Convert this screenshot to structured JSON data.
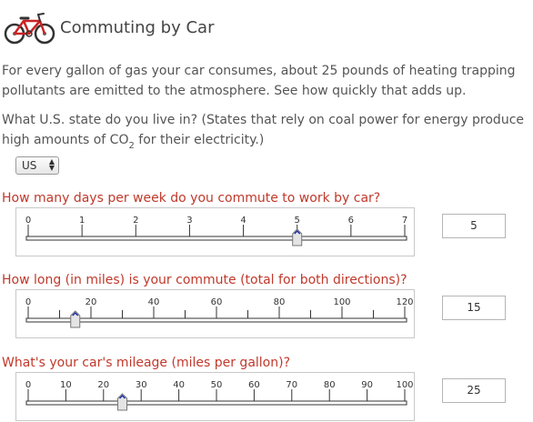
{
  "header": {
    "title": "Commuting by Car",
    "icon": "bicycle-icon"
  },
  "intro": "For every gallon of gas your car consumes, about 25 pounds of heating trapping pollutants are emitted to the atmosphere.  See how quickly that adds up.",
  "state_question": {
    "before": "What U.S. state do you live in? (States that rely on coal power for energy produce high amounts of CO",
    "sub": "2",
    "after": " for their electricity.)"
  },
  "state_select": {
    "value": "US"
  },
  "questions": [
    {
      "label": "How many days per week do you commute to work by car?",
      "min": 0,
      "max": 7,
      "value": 5,
      "tick_labels": [
        "0",
        "1",
        "2",
        "3",
        "4",
        "5",
        "6",
        "7"
      ],
      "minor_ticks": 0,
      "display_value": "5"
    },
    {
      "label": "How long (in miles) is your commute (total for both directions)?",
      "min": 0,
      "max": 120,
      "value": 15,
      "tick_labels": [
        "0",
        "20",
        "40",
        "60",
        "80",
        "100",
        "120"
      ],
      "minor_ticks": 1,
      "display_value": "15"
    },
    {
      "label": "What's your car's mileage (miles per gallon)?",
      "min": 0,
      "max": 100,
      "value": 25,
      "tick_labels": [
        "0",
        "10",
        "20",
        "30",
        "40",
        "50",
        "60",
        "70",
        "80",
        "90",
        "100"
      ],
      "minor_ticks": 0,
      "display_value": "25"
    }
  ],
  "colors": {
    "question": "#c0392b",
    "thumb_mark": "#1a2ea8",
    "bike_frame": "#cc2222"
  }
}
